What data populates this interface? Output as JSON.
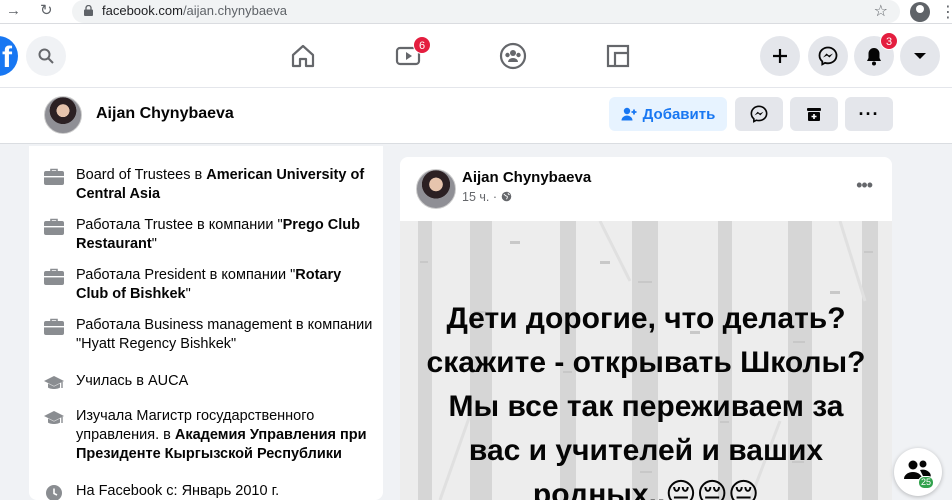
{
  "browser": {
    "url_host": "facebook.com",
    "url_path": "/aijan.chynybaeva"
  },
  "nav": {
    "watch_badge": "6",
    "notifications_badge": "3"
  },
  "profile": {
    "name": "Aijan Chynybaeva",
    "add_friend_label": "Добавить"
  },
  "intro": {
    "items": [
      {
        "icon": "briefcase-icon",
        "text": "Board of Trustees в ",
        "bold": "American University of Central Asia",
        "suffix": ""
      },
      {
        "icon": "briefcase-icon",
        "text": "Работала Trustee в компании \"",
        "bold": "Prego Club Restaurant",
        "suffix": "\""
      },
      {
        "icon": "briefcase-icon",
        "text": "Работала President в компании \"",
        "bold": "Rotary Club of Bishkek",
        "suffix": "\""
      },
      {
        "icon": "briefcase-icon",
        "text": "Работала Business management в компании \"Hyatt Regency Bishkek\"",
        "bold": "",
        "suffix": ""
      },
      {
        "icon": "graduation-cap-icon",
        "text": "Училась в AUCA",
        "bold": "",
        "suffix": ""
      },
      {
        "icon": "graduation-cap-icon",
        "text": "Изучала Магистр государственного управления. в ",
        "bold": "Академия Управления при Президенте Кыргызской Республики",
        "suffix": ""
      },
      {
        "icon": "clock-icon",
        "text": "На Facebook с: Январь 2010 г.",
        "bold": "",
        "suffix": ""
      }
    ]
  },
  "post": {
    "author": "Aijan Chynybaeva",
    "time": "15 ч.",
    "text": "Дети дорогие, что делать? скажите - открывать Школы? Мы все так переживаем за вас и учителей и ваших родных..😔😔😔"
  },
  "contacts": {
    "count": "25"
  },
  "colors": {
    "brand": "#1877f2",
    "badge": "#e41e3f",
    "online": "#31a24c"
  }
}
